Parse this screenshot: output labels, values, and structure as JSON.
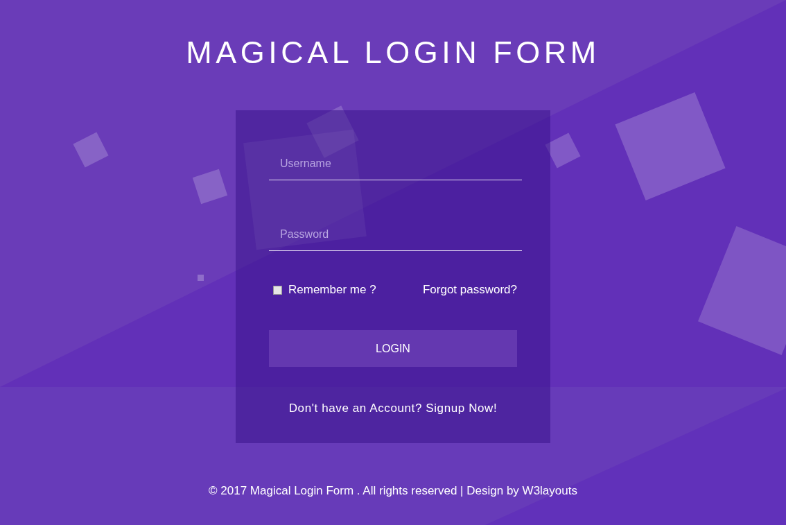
{
  "title": "MAGICAL LOGIN FORM",
  "form": {
    "username": {
      "placeholder": "Username"
    },
    "password": {
      "placeholder": "Password"
    },
    "remember": {
      "label": "Remember me ?",
      "checked": false
    },
    "forgot_link": "Forgot password?",
    "login_button": "LOGIN",
    "signup": {
      "text": "Don't have an Account?",
      "link": "Signup Now!"
    }
  },
  "footer": "© 2017 Magical Login Form . All rights reserved | Design by W3layouts"
}
